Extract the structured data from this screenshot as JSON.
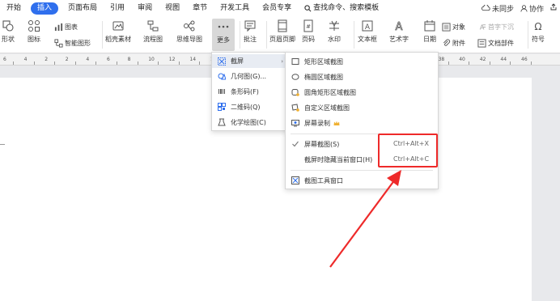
{
  "menubar": {
    "tabs": [
      "开始",
      "插入",
      "页面布局",
      "引用",
      "审阅",
      "视图",
      "章节",
      "开发工具",
      "会员专享"
    ],
    "active_tab": "插入",
    "search": "查找命令、搜索模板",
    "sync": "未同步",
    "collab": "协作"
  },
  "ribbon": {
    "shape": "形状",
    "icon": "图标",
    "chart": "图表",
    "smart_graphic": "智能图形",
    "stock_material": "稻壳素材",
    "flowchart": "流程图",
    "mindmap": "思维导图",
    "more": "更多",
    "comment": "批注",
    "header_footer": "页眉页脚",
    "page_number": "页码",
    "watermark": "水印",
    "textbox": "文本框",
    "wordart": "艺术字",
    "date": "日期",
    "object": "对象",
    "attachment": "附件",
    "drop_cap": "首字下沉",
    "doc_parts": "文档部件",
    "symbol": "符号"
  },
  "ruler": {
    "marks": [
      "6",
      "4",
      "2",
      "2",
      "4",
      "6",
      "8",
      "10",
      "12",
      "14",
      "16",
      "18",
      "20",
      "22",
      "24",
      "26",
      "28",
      "30",
      "32",
      "34",
      "36",
      "38",
      "40",
      "42",
      "44",
      "46"
    ]
  },
  "more_menu": {
    "items": [
      "截屏",
      "几何图(G)...",
      "条形码(F)",
      "二维码(Q)",
      "化学绘图(C)"
    ]
  },
  "screenshot_menu": {
    "items": [
      "矩形区域截图",
      "椭圆区域截图",
      "圆角矩形区域截图",
      "自定义区域截图",
      "屏幕录制"
    ],
    "screen_capture": "屏幕截图(S)",
    "screen_capture_shortcut": "Ctrl+Alt+X",
    "hide_window": "截屏时隐藏当前窗口(H)",
    "hide_window_shortcut": "Ctrl+Alt+C",
    "toolbar_window": "截图工具窗口"
  },
  "colors": {
    "accent": "#2f6fed",
    "highlight": "#ee2a2a",
    "crown": "#f0b030"
  }
}
